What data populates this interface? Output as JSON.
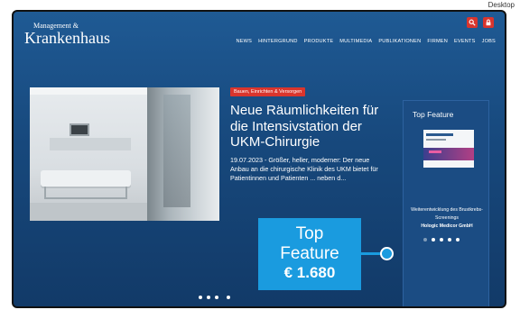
{
  "desktop_label": "Desktop",
  "site": {
    "logo_small": "Management &",
    "logo_big": "Krankenhaus"
  },
  "header": {
    "icons": [
      "search-icon",
      "lock-icon"
    ],
    "nav": [
      "NEWS",
      "HINTERGRUND",
      "PRODUKTE",
      "MULTIMEDIA",
      "PUBLIKATIONEN",
      "FIRMEN",
      "EVENTS",
      "JOBS"
    ]
  },
  "hero": {
    "tag": "Bauen, Einrichten & Versorgen",
    "headline": "Neue Räumlichkeiten für die Intensivstation der UKM-Chirurgie",
    "teaser": "19.07.2023 - Größer, heller, moderner: Der neue Anbau an die chirurgische Klinik des UKM bietet für Patientinnen und Patienten ... neben d..."
  },
  "sidebar": {
    "title": "Top Feature",
    "caption": "Weiterentwicklung des Brustkrebs-Screenings",
    "company": "Hologic Medicor GmbH"
  },
  "callout": {
    "line1": "Top",
    "line2": "Feature",
    "price": "€ 1.680"
  },
  "colors": {
    "background": "#17487c",
    "accent_red": "#d9352d",
    "callout_blue": "#1a9bdf"
  }
}
